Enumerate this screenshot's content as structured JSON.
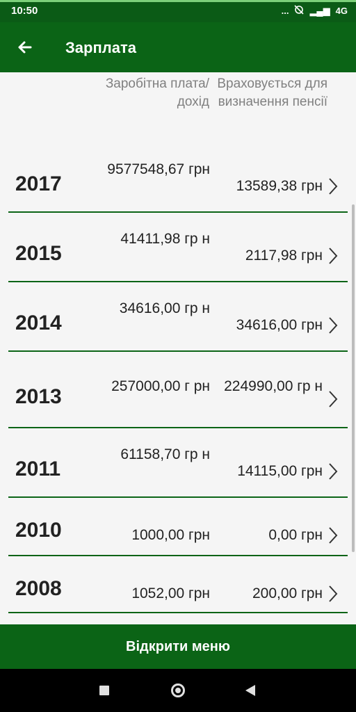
{
  "status": {
    "time": "10:50",
    "dots": "...",
    "network": "4G",
    "signal": "▂▄▆"
  },
  "appbar": {
    "title": "Зарплата",
    "back_icon": "arrow-left"
  },
  "header": {
    "col1": "Заробітна плата/ дохід",
    "col2": "Враховується для визначення пенсії"
  },
  "rows": [
    {
      "year": "2017",
      "salary": "9577548,67 грн",
      "counted": "13589,38 грн"
    },
    {
      "year": "2015",
      "salary": "41411,98 гр н",
      "counted": "2117,98 грн"
    },
    {
      "year": "2014",
      "salary": "34616,00 гр н",
      "counted": "34616,00 грн"
    },
    {
      "year": "2013",
      "salary": "257000,00 г рн",
      "counted": "224990,00 гр н"
    },
    {
      "year": "2011",
      "salary": "61158,70 гр н",
      "counted": "14115,00 грн"
    },
    {
      "year": "2010",
      "salary": "1000,00 грн",
      "counted": "0,00 грн"
    },
    {
      "year": "2008",
      "salary": "1052,00 грн",
      "counted": "200,00 грн"
    }
  ],
  "menu_button": "Відкрити меню",
  "colors": {
    "primary": "#0b6416",
    "statusbar": "#0b5b16",
    "divider": "#0b6416",
    "header_text": "#808080"
  }
}
